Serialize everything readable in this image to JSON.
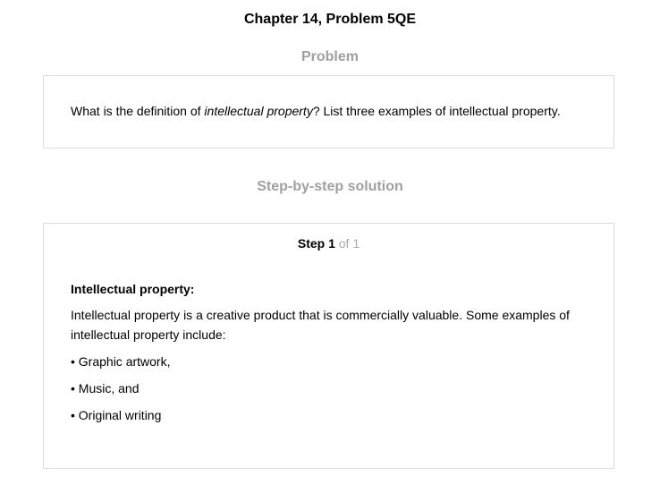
{
  "page": {
    "title": "Chapter 14, Problem 5QE"
  },
  "problem": {
    "heading": "Problem",
    "text_before": "What is the definition of ",
    "text_italic": "intellectual property",
    "text_after": "? List three examples of intellectual property."
  },
  "solution": {
    "heading": "Step-by-step solution",
    "step_label": "Step 1",
    "step_of": " of 1",
    "subheading": "Intellectual property:",
    "paragraph": "Intellectual property is a creative product that is commercially valuable. Some examples of intellectual property include:",
    "bullets": [
      "• Graphic artwork,",
      "• Music, and",
      "• Original writing"
    ]
  }
}
